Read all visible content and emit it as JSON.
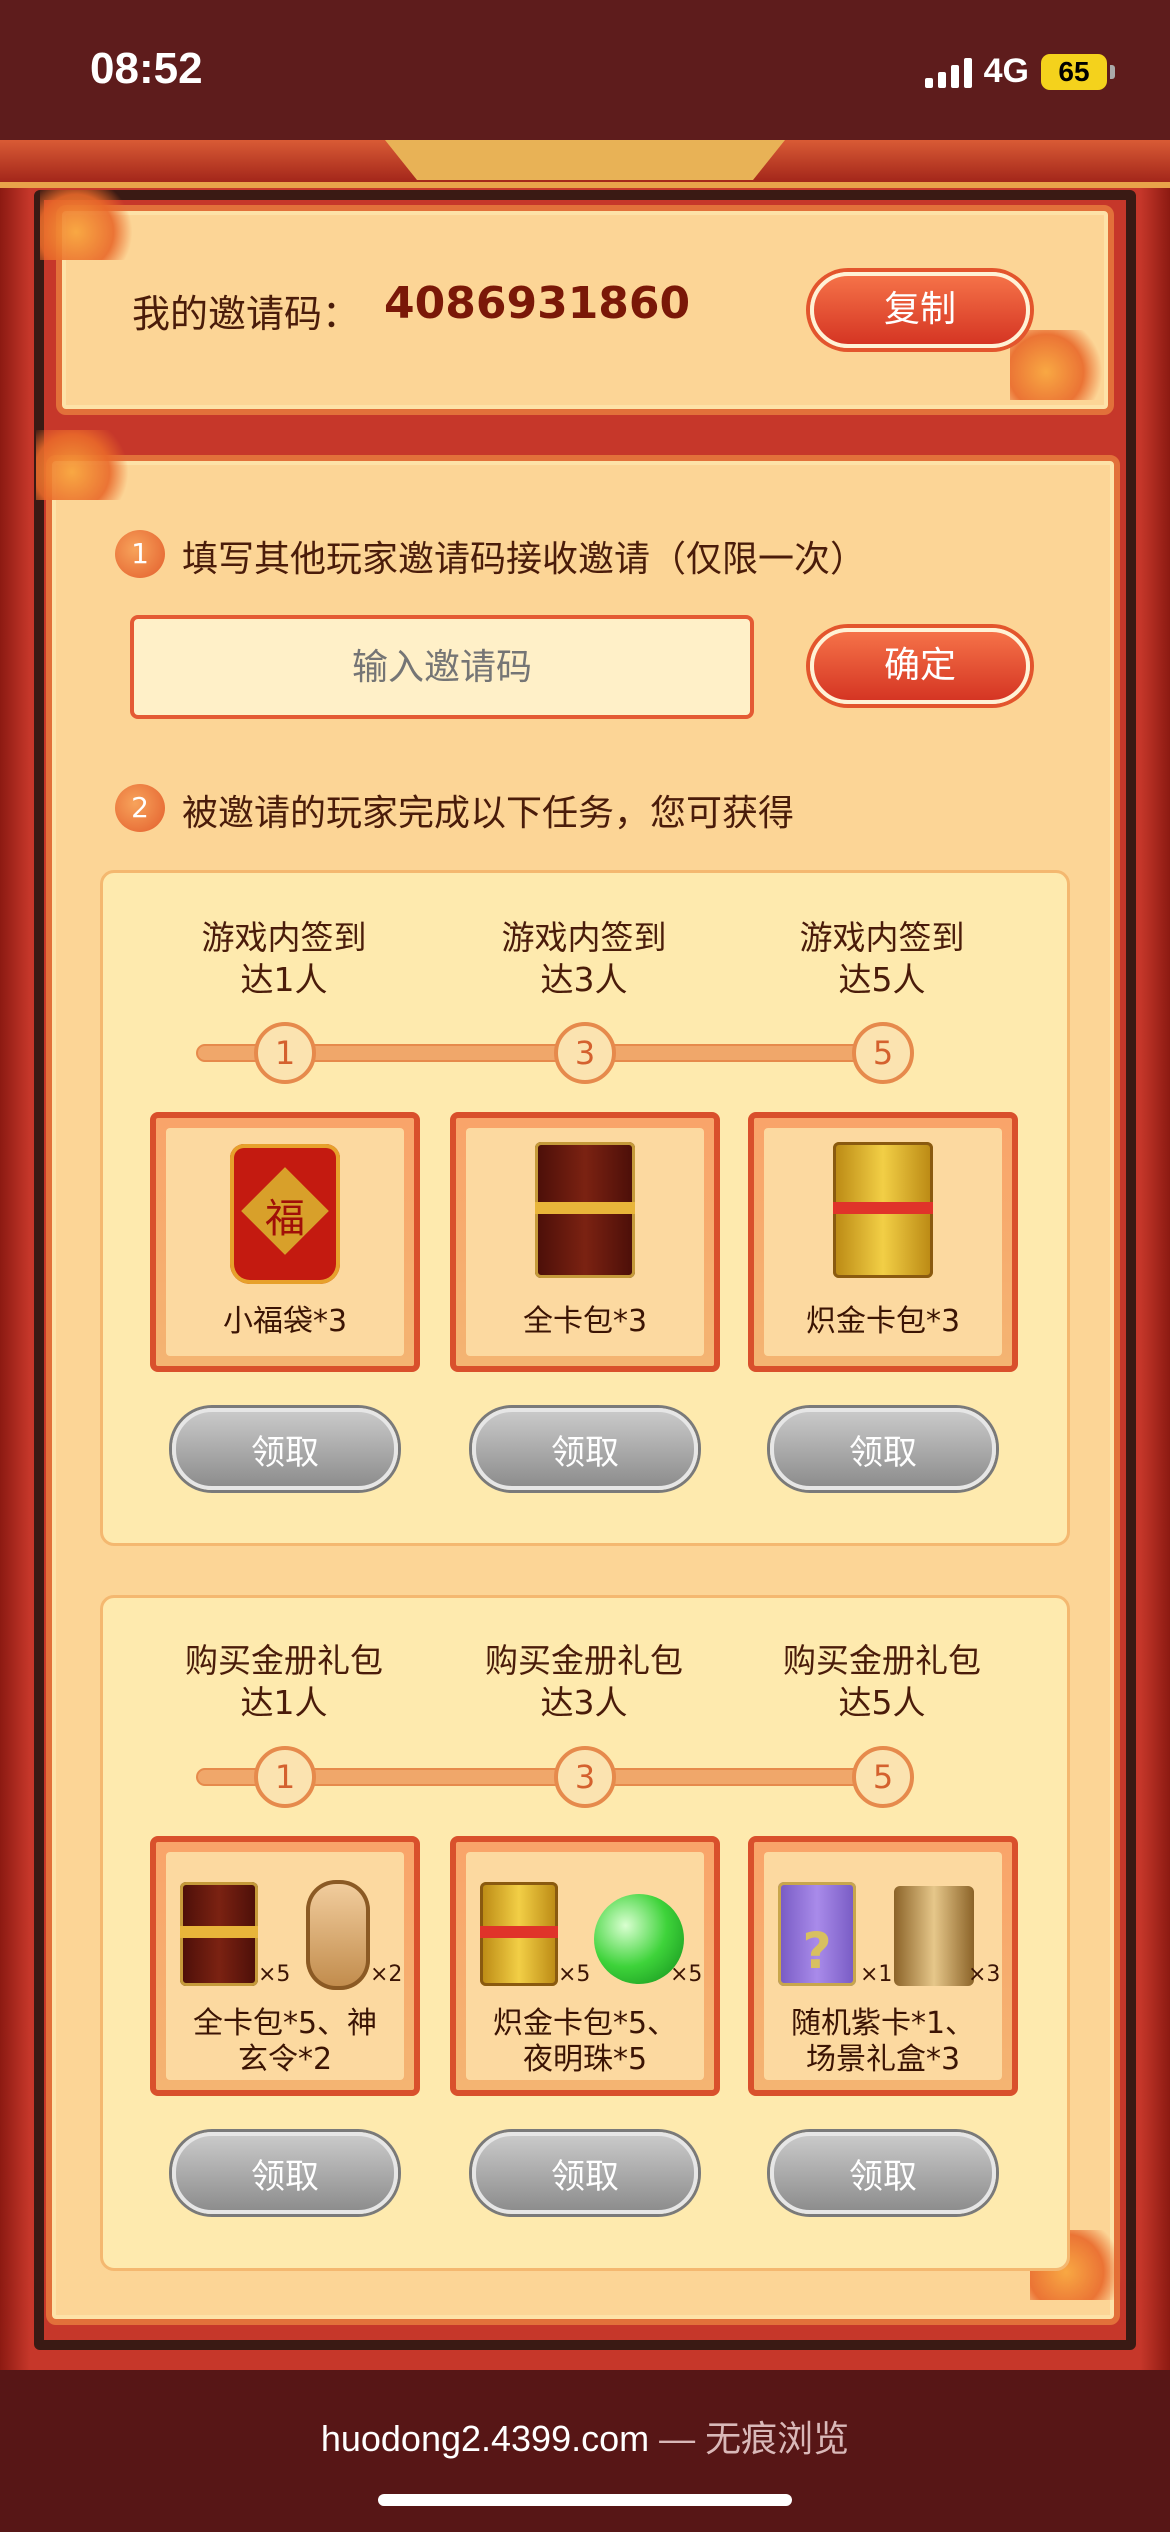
{
  "status_bar": {
    "time": "08:52",
    "network": "4G",
    "battery": "65"
  },
  "invite_code": {
    "label": "我的邀请码：",
    "value": "4086931860",
    "copy_label": "复制"
  },
  "step1": {
    "number": "1",
    "text": "填写其他玩家邀请码接收邀请（仅限一次）",
    "input_placeholder": "输入邀请码",
    "confirm_label": "确定"
  },
  "step2": {
    "number": "2",
    "text": "被邀请的玩家完成以下任务，您可获得"
  },
  "tasks": [
    {
      "milestones": [
        {
          "title_line1": "游戏内签到",
          "title_line2": "达1人",
          "node": "1",
          "reward": "小福袋*3",
          "reward_line2": "",
          "claim_label": "领取"
        },
        {
          "title_line1": "游戏内签到",
          "title_line2": "达3人",
          "node": "3",
          "reward": "全卡包*3",
          "reward_line2": "",
          "claim_label": "领取"
        },
        {
          "title_line1": "游戏内签到",
          "title_line2": "达5人",
          "node": "5",
          "reward": "炽金卡包*3",
          "reward_line2": "",
          "claim_label": "领取"
        }
      ]
    },
    {
      "milestones": [
        {
          "title_line1": "购买金册礼包",
          "title_line2": "达1人",
          "node": "1",
          "reward": "全卡包*5、神",
          "reward_line2": "玄令*2",
          "qty_a": "×5",
          "qty_b": "×2",
          "claim_label": "领取"
        },
        {
          "title_line1": "购买金册礼包",
          "title_line2": "达3人",
          "node": "3",
          "reward": "炽金卡包*5、",
          "reward_line2": "夜明珠*5",
          "qty_a": "×5",
          "qty_b": "×5",
          "claim_label": "领取"
        },
        {
          "title_line1": "购买金册礼包",
          "title_line2": "达5人",
          "node": "5",
          "reward": "随机紫卡*1、",
          "reward_line2": "场景礼盒*3",
          "qty_a": "×1",
          "qty_b": "×3",
          "claim_label": "领取"
        }
      ]
    }
  ],
  "icons": {
    "fudai_char": "福",
    "question_mark": "?"
  },
  "browser": {
    "url": "huodong2.4399.com",
    "mode": " — 无痕浏览"
  },
  "colors": {
    "accent_red": "#d53523",
    "panel": "#fcd596",
    "frame": "#c6372a",
    "claim_gray": "#8d8d8d"
  }
}
